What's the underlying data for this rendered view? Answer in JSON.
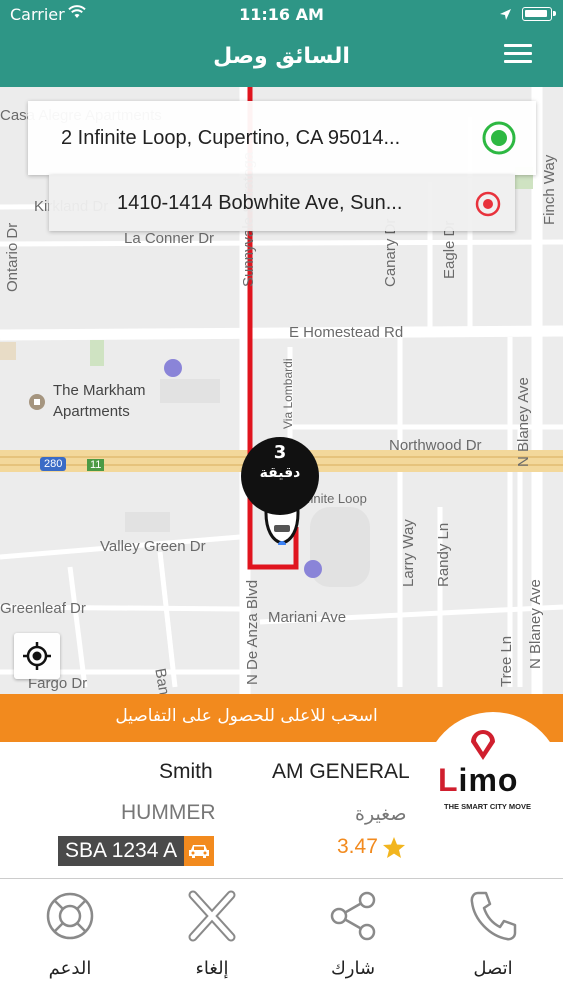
{
  "status_bar": {
    "carrier": "Carrier",
    "time": "11:16 AM"
  },
  "header": {
    "title": "السائق وصل"
  },
  "route": {
    "pickup": "2 Infinite Loop,  Cupertino,  CA 95014...",
    "dropoff": "1410-1414 Bobwhite Ave,  Sun..."
  },
  "eta": {
    "value": "3",
    "unit": "دقيقة"
  },
  "map_labels": {
    "casa": "Casa Alegre Apartments",
    "kirkland": "Kirkland Dr",
    "la_conner": "La Conner Dr",
    "ontario": "Ontario Dr",
    "sunnyvale": "Sunnyvale Saratoga",
    "canary": "Canary Dr",
    "eagle": "Eagle Dr",
    "finch": "Finch Way",
    "homestead": "E Homestead Rd",
    "markham": "The Markham",
    "markham2": "Apartments",
    "via_lombardi": "Via Lombardi",
    "northwood": "Northwood Dr",
    "n_blaney": "N Blaney Ave",
    "shield_280": "280",
    "shield_11": "11",
    "infinite_loop": "Infinite Loop",
    "valley_green": "Valley Green Dr",
    "larry": "Larry Way",
    "randy": "Randy Ln",
    "n_de_anza": "N De Anza Blvd",
    "bandley": "Bandley Dr",
    "mariani": "Mariani Ave",
    "greenleaf": "Greenleaf Dr",
    "fargo": "Fargo Dr",
    "n_blaney2": "N Blaney Ave",
    "tree_ln": "Tree Ln"
  },
  "banner": {
    "text": "اسحب للاعلى للحصول على التفاصيل"
  },
  "logo": {
    "word_first": "L",
    "word_rest": "imo",
    "tagline": "THE SMART CITY MOVE"
  },
  "driver": {
    "name": "Smith",
    "make": "AM GENERAL",
    "model": "HUMMER",
    "size": "صغيرة",
    "plate": "SBA 1234 A",
    "rating": "3.47"
  },
  "tabs": [
    {
      "label": "الدعم",
      "icon": "lifebuoy-icon"
    },
    {
      "label": "إلغاء",
      "icon": "cancel-x-icon"
    },
    {
      "label": "شارك",
      "icon": "share-icon"
    },
    {
      "label": "اتصل",
      "icon": "phone-icon"
    }
  ],
  "colors": {
    "header": "#2e9686",
    "banner": "#f28a1e",
    "route": "#e0141e",
    "pickup_marker": "#2db842",
    "dropoff_marker": "#e8323c"
  }
}
